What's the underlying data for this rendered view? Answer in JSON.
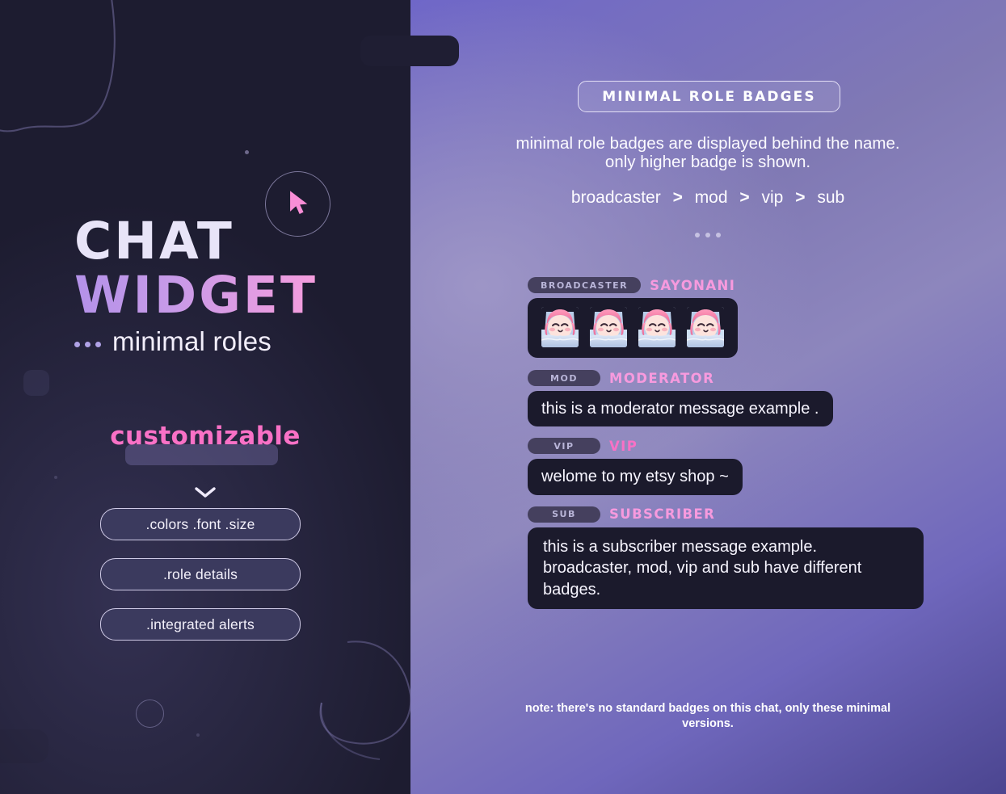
{
  "left": {
    "logo_line1": "CHAT",
    "logo_line2": "WIDGET",
    "subtitle": "minimal roles",
    "customizable_label": "customizable",
    "chevron_icon": "chevron-down-icon",
    "cursor_icon": "cursor-arrow-icon",
    "pills": [
      {
        "label": ".colors .font .size"
      },
      {
        "label": ".role details"
      },
      {
        "label": ".integrated alerts"
      }
    ]
  },
  "right": {
    "title_badge": "MINIMAL ROLE BADGES",
    "description": "minimal role badges are displayed behind the name. only higher badge is shown.",
    "hierarchy": {
      "items": [
        "broadcaster",
        "mod",
        "vip",
        "sub"
      ],
      "separator": ">"
    },
    "dots_separator": "...",
    "chat_rows": [
      {
        "badge": "BROADCASTER",
        "username": "SAYONANI",
        "username_color": "#f79ade",
        "type": "emotes",
        "emote_count": 4,
        "emote_name": "sleepy-pink-hair-character-emote",
        "message": ""
      },
      {
        "badge": "MOD",
        "username": "MODERATOR",
        "username_color": "#f79ade",
        "type": "text",
        "message": "this is a moderator message example ."
      },
      {
        "badge": "VIP",
        "username": "VIP",
        "username_color": "#f971c6",
        "type": "text",
        "message": "welome to my etsy shop ~"
      },
      {
        "badge": "SUB",
        "username": "SUBSCRIBER",
        "username_color": "#f79ade",
        "type": "text-multiline",
        "message": "this is a subscriber message example. broadcaster, mod, vip and sub have different badges."
      }
    ],
    "note": "note: there's no standard badges on this chat, only these minimal versions."
  },
  "colors": {
    "left_bg": "#1d1c30",
    "right_bg_light": "#8d86bd",
    "right_bg_deep": "#4b4590",
    "accent_pink": "#f971c6",
    "bubble_bg": "#1b1a2c",
    "badge_pill_bg": "#45405e",
    "badge_text": "#b9b5d8"
  }
}
